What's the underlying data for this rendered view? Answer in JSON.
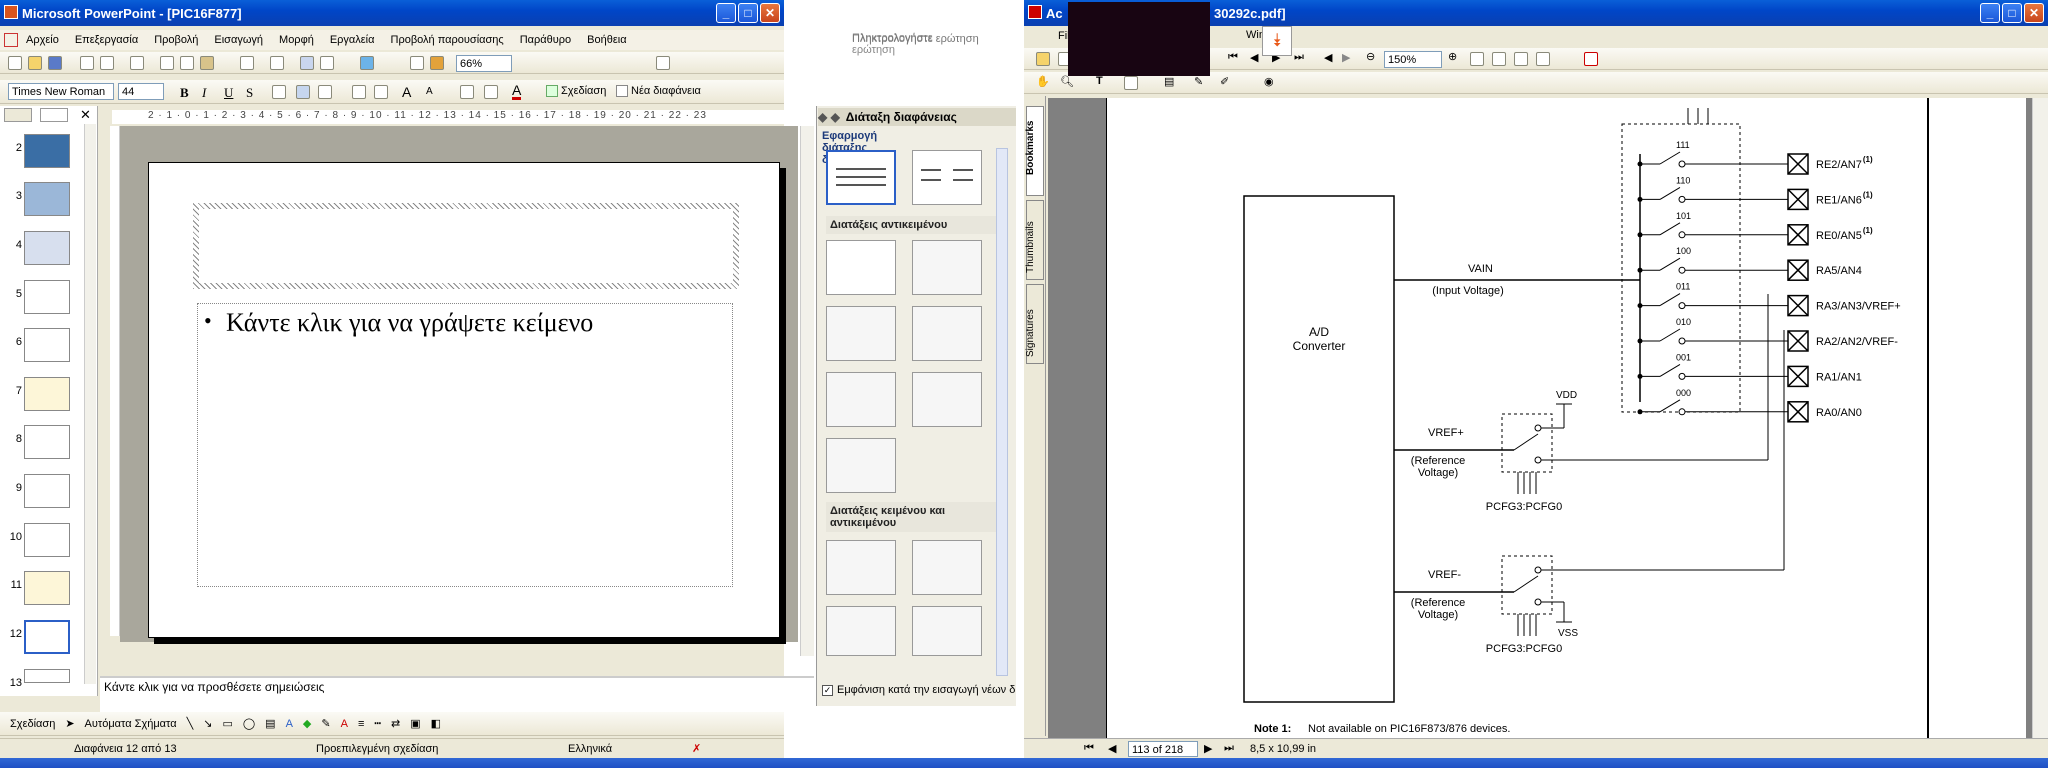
{
  "ppt": {
    "title": "Microsoft PowerPoint - [PIC16F877]",
    "menu": [
      "Αρχείο",
      "Επεξεργασία",
      "Προβολή",
      "Εισαγωγή",
      "Μορφή",
      "Εργαλεία",
      "Προβολή παρουσίασης",
      "Παράθυρο",
      "Βοήθεια"
    ],
    "help_placeholder": "Πληκτρολογήστε ερώτηση",
    "zoom": "66%",
    "font_name": "Times New Roman",
    "font_size": "44",
    "design_label": "Σχεδίαση",
    "new_slide_label": "Νέα διαφάνεια",
    "ruler_h": "2 · 1 · 0 · 1 · 2 · 3 · 4 · 5 · 6 · 7 · 8 · 9 · 10 · 11 · 12 · 13 · 14 · 15 · 16 · 17 · 18 · 19 · 20 · 21 · 22 · 23",
    "slide_numbers": [
      "2",
      "3",
      "4",
      "5",
      "6",
      "7",
      "8",
      "9",
      "10",
      "11",
      "12",
      "13"
    ],
    "body_placeholder": "Κάντε κλικ για να γράψετε κείμενο",
    "notes_placeholder": "Κάντε κλικ για να προσθέσετε σημειώσεις",
    "taskpane": {
      "title": "Διάταξη διαφάνειας",
      "apply_label": "Εφαρμογή διάταξης διαφάνειας:",
      "section_content": "Διατάξεις αντικειμένου",
      "section_text_content": "Διατάξεις κειμένου και αντικειμένου",
      "show_checkbox": "Εμφάνιση κατά την εισαγωγή νέων δ"
    },
    "drawing_label": "Σχεδίαση",
    "autoshapes_label": "Αυτόματα Σχήματα",
    "status": {
      "slide": "Διαφάνεια 12 από 13",
      "design": "Προεπιλεγμένη σχεδίαση",
      "language": "Ελληνικά"
    }
  },
  "acro": {
    "title_left": "Ac",
    "title_right": "30292c.pdf]",
    "menu_visible": [
      "File",
      "Window"
    ],
    "zoom": "150%",
    "side_tabs": [
      "Bookmarks",
      "Thumbnails",
      "Signatures"
    ],
    "page_field": "113 of 218",
    "page_size": "8,5 x 10,99 in",
    "schematic": {
      "converter": [
        "A/D",
        "Converter"
      ],
      "vain": "VAIN",
      "vain_sub": "(Input Voltage)",
      "codes": [
        "111",
        "110",
        "101",
        "100",
        "011",
        "010",
        "001",
        "000"
      ],
      "pins": [
        "RE2/AN7",
        "RE1/AN6",
        "RE0/AN5",
        "RA5/AN4",
        "RA3/AN3/VREF+",
        "RA2/AN2/VREF-",
        "RA1/AN1",
        "RA0/AN0"
      ],
      "sup": "(1)",
      "vdd": "VDD",
      "vss": "VSS",
      "vref_plus": "VREF+",
      "vref_minus": "VREF-",
      "ref_voltage": [
        "(Reference",
        "Voltage)"
      ],
      "pcfg": "PCFG3:PCFG0",
      "note_label": "Note 1:",
      "note_text": "Not available on PIC16F873/876 devices."
    }
  },
  "colors": {
    "xp_blue": "#0a3fb0",
    "pane_bg": "#ece9d8",
    "slide_area": "#a9a79c"
  }
}
